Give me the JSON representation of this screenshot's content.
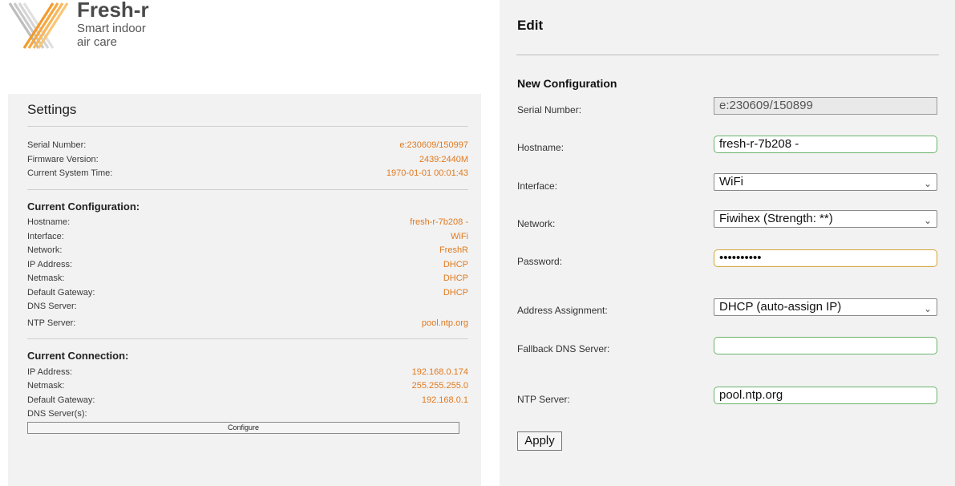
{
  "brand": {
    "name": "Fresh-r",
    "tagline_line1": "Smart indoor",
    "tagline_line2": "air care",
    "colors": {
      "accent": "#e07a1f",
      "logo_orange": "#f39a2b",
      "logo_gray": "#bdbdbd"
    }
  },
  "settings": {
    "title": "Settings",
    "system": [
      {
        "label": "Serial Number:",
        "value": "e:230609/150997"
      },
      {
        "label": "Firmware Version:",
        "value": "2439:2440M"
      },
      {
        "label": "Current System Time:",
        "value": "1970-01-01 00:01:43"
      }
    ],
    "current_configuration_title": "Current Configuration:",
    "current_configuration": [
      {
        "label": "Hostname:",
        "value": "fresh-r-7b208 -"
      },
      {
        "label": "Interface:",
        "value": "WiFi"
      },
      {
        "label": "Network:",
        "value": "FreshR"
      },
      {
        "label": "IP Address:",
        "value": "DHCP"
      },
      {
        "label": "Netmask:",
        "value": "DHCP"
      },
      {
        "label": "Default Gateway:",
        "value": "DHCP"
      },
      {
        "label": "DNS Server:",
        "value": ""
      },
      {
        "label": "NTP Server:",
        "value": "pool.ntp.org"
      }
    ],
    "current_connection_title": "Current Connection:",
    "current_connection": [
      {
        "label": "IP Address:",
        "value": "192.168.0.174"
      },
      {
        "label": "Netmask:",
        "value": "255.255.255.0"
      },
      {
        "label": "Default Gateway:",
        "value": "192.168.0.1"
      },
      {
        "label": "DNS Server(s):",
        "value": ""
      }
    ],
    "configure_button": "Configure"
  },
  "edit": {
    "title": "Edit",
    "section_title": "New Configuration",
    "fields": {
      "serial": {
        "label": "Serial Number:",
        "value": "e:230609/150899"
      },
      "hostname": {
        "label": "Hostname:",
        "value": "fresh-r-7b208 -"
      },
      "interface": {
        "label": "Interface:",
        "value": "WiFi"
      },
      "network": {
        "label": "Network:",
        "value": "Fiwihex (Strength: **)"
      },
      "password": {
        "label": "Password:",
        "value": "••••••••••"
      },
      "address": {
        "label": "Address Assignment:",
        "value": "DHCP (auto-assign IP)"
      },
      "fallback_dns": {
        "label": "Fallback DNS Server:",
        "value": ""
      },
      "ntp": {
        "label": "NTP Server:",
        "value": "pool.ntp.org"
      }
    },
    "apply_button": "Apply"
  }
}
